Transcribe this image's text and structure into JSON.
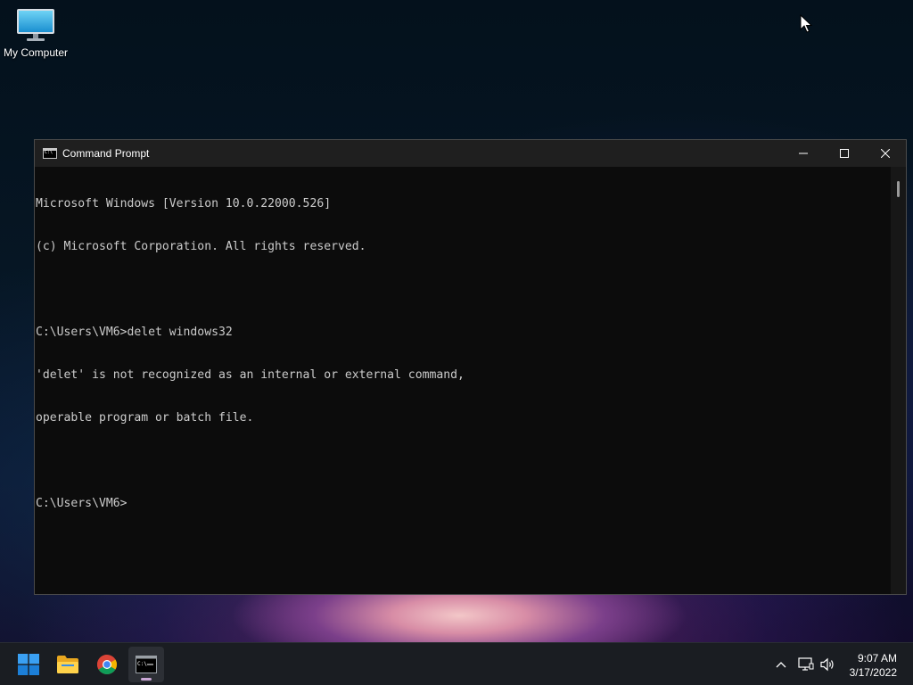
{
  "desktop": {
    "icons": [
      {
        "label": "My Computer",
        "icon": "monitor-icon"
      }
    ]
  },
  "window": {
    "title": "Command Prompt",
    "icon": "cmd-icon",
    "controls": [
      "minimize-icon",
      "maximize-icon",
      "close-icon"
    ],
    "console_lines": [
      "Microsoft Windows [Version 10.0.22000.526]",
      "(c) Microsoft Corporation. All rights reserved.",
      "",
      "C:\\Users\\VM6>delet windows32",
      "'delet' is not recognized as an internal or external command,",
      "operable program or batch file.",
      "",
      "C:\\Users\\VM6>"
    ]
  },
  "taskbar": {
    "apps": [
      {
        "name": "start-button",
        "icon": "windows-logo-icon"
      },
      {
        "name": "file-explorer",
        "icon": "folder-icon"
      },
      {
        "name": "chrome",
        "icon": "chrome-icon"
      },
      {
        "name": "command-prompt",
        "icon": "terminal-icon",
        "active": true
      }
    ],
    "tray": {
      "icons": [
        "chevron-up-icon",
        "network-icon",
        "volume-icon"
      ],
      "time": "9:07 AM",
      "date": "3/17/2022"
    }
  },
  "colors": {
    "console_bg": "#0c0c0c",
    "console_text": "#cccccc",
    "titlebar_bg": "#1f1f1f",
    "taskbar_bg": "#1a1d22"
  }
}
